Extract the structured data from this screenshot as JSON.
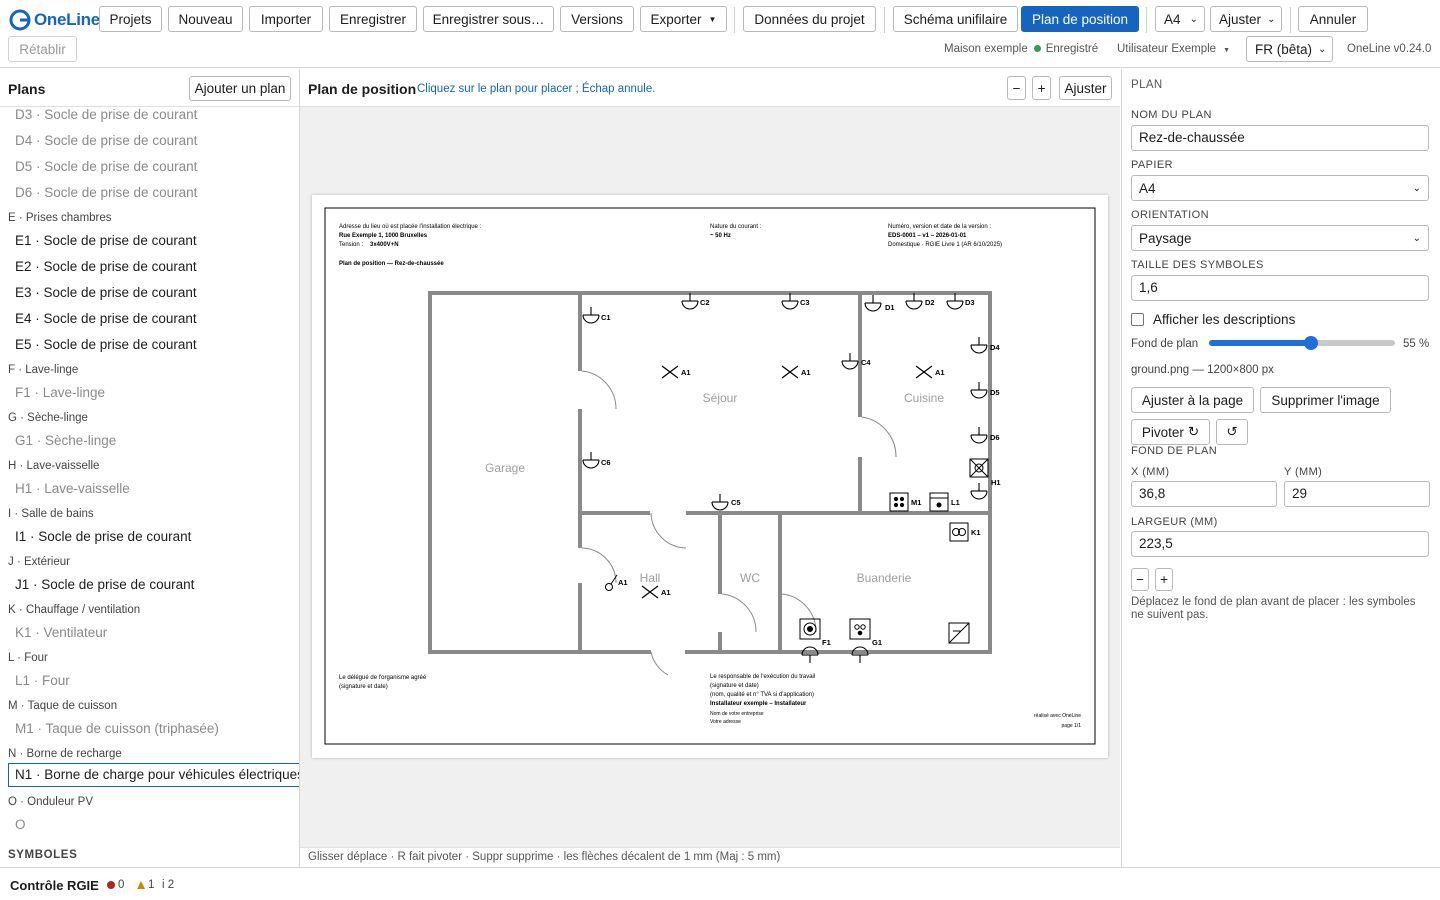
{
  "app": {
    "name": "OneLine",
    "version": "OneLine v0.24.0",
    "accent": "#1565c0"
  },
  "toolbar": {
    "projects": "Projets",
    "new": "Nouveau",
    "import": "Importer",
    "save": "Enregistrer",
    "save_as": "Enregistrer sous…",
    "versions": "Versions",
    "export": "Exporter",
    "project_data": "Données du projet",
    "single_line": "Schéma unifilaire",
    "position_plan": "Plan de position",
    "paper": "A4",
    "fit": "Ajuster",
    "undo": "Annuler",
    "redo": "Rétablir"
  },
  "status": {
    "project": "Maison exemple",
    "saved": "Enregistré",
    "user": "Utilisateur Exemple",
    "language": "FR (bêta)"
  },
  "left": {
    "title": "Plans",
    "add_plan": "Ajouter un plan",
    "groups": [
      {
        "items": [
          {
            "label": "D3 · Socle de prise de courant",
            "placed": false
          },
          {
            "label": "D4 · Socle de prise de courant",
            "placed": false
          },
          {
            "label": "D5 · Socle de prise de courant",
            "placed": false
          },
          {
            "label": "D6 · Socle de prise de courant",
            "placed": false
          }
        ]
      },
      {
        "label": "E · Prises chambres",
        "items": [
          {
            "label": "E1 · Socle de prise de courant",
            "placed": true
          },
          {
            "label": "E2 · Socle de prise de courant",
            "placed": true
          },
          {
            "label": "E3 · Socle de prise de courant",
            "placed": true
          },
          {
            "label": "E4 · Socle de prise de courant",
            "placed": true
          },
          {
            "label": "E5 · Socle de prise de courant",
            "placed": true
          }
        ]
      },
      {
        "label": "F · Lave-linge",
        "items": [
          {
            "label": "F1 · Lave-linge",
            "placed": false
          }
        ]
      },
      {
        "label": "G · Sèche-linge",
        "items": [
          {
            "label": "G1 · Sèche-linge",
            "placed": false
          }
        ]
      },
      {
        "label": "H · Lave-vaisselle",
        "items": [
          {
            "label": "H1 · Lave-vaisselle",
            "placed": false
          }
        ]
      },
      {
        "label": "I · Salle de bains",
        "items": [
          {
            "label": "I1 · Socle de prise de courant",
            "placed": true
          }
        ]
      },
      {
        "label": "J · Extérieur",
        "items": [
          {
            "label": "J1 · Socle de prise de courant",
            "placed": true
          }
        ]
      },
      {
        "label": "K · Chauffage / ventilation",
        "items": [
          {
            "label": "K1 · Ventilateur",
            "placed": false
          }
        ]
      },
      {
        "label": "L · Four",
        "items": [
          {
            "label": "L1 · Four",
            "placed": false
          }
        ]
      },
      {
        "label": "M · Taque de cuisson",
        "items": [
          {
            "label": "M1 · Taque de cuisson (triphasée)",
            "placed": false
          }
        ]
      },
      {
        "label": "N · Borne de recharge",
        "items": [
          {
            "label": "N1 · Borne de charge pour véhicules électriques",
            "placed": true,
            "selected": true
          }
        ]
      },
      {
        "label": "O · Onduleur PV",
        "items": [
          {
            "label": "O",
            "placed": false
          }
        ]
      }
    ],
    "symbols_heading": "SYMBOLES"
  },
  "center": {
    "title": "Plan de position",
    "hint": "Cliquez sur le plan pour placer ; Échap annule.",
    "zoom_out": "−",
    "zoom_in": "+",
    "fit": "Ajuster",
    "footer": "Glisser déplace · R fait pivoter · Suppr supprime · les flèches décalent de 1 mm (Maj : 5 mm)"
  },
  "sheet": {
    "address_label": "Adresse du lieu où est placée l'installation électrique :",
    "address": "Rue Exemple 1, 1000 Bruxelles",
    "voltage_label": "Tension :",
    "voltage": "3x400V+N",
    "current_label": "Nature du courant :",
    "current": "~ 50 Hz",
    "version_label": "Numéro, version et date de la version :",
    "version": "EDS-0001 – v1 – 2026-01-01",
    "regulation": "Domestique · RGIE Livre 1 (AR 6/10/2025)",
    "plan_title": "Plan de position — Rez-de-chaussée",
    "delegate_1": "Le délégué de l'organisme agréé",
    "delegate_2": "(signature et date)",
    "resp_1": "Le responsable de l'exécution du travail",
    "resp_2": "(signature et date)",
    "resp_3": "(nom, qualité et n° TVA si d'application)",
    "installer": "Installateur exemple – Installateur",
    "company": "Nom de votre entreprise",
    "company_address": "Votre adresse",
    "made_with": "réalisé avec OneLine",
    "page": "page 1/1",
    "rooms": {
      "garage": "Garage",
      "sejour": "Séjour",
      "cuisine": "Cuisine",
      "hall": "Hall",
      "wc": "WC",
      "buanderie": "Buanderie"
    },
    "symbols": {
      "c1": "C1",
      "c2": "C2",
      "c3": "C3",
      "c4": "C4",
      "c5": "C5",
      "c6": "C6",
      "d1": "D1",
      "d2": "D2",
      "d3": "D3",
      "d4": "D4",
      "d5": "D5",
      "d6": "D6",
      "a1": "A1",
      "h1": "H1",
      "m1": "M1",
      "l1": "L1",
      "k1": "K1",
      "f1": "F1",
      "g1": "G1"
    }
  },
  "right": {
    "section": "PLAN",
    "name_label": "NOM DU PLAN",
    "name_value": "Rez-de-chaussée",
    "paper_label": "PAPIER",
    "paper_value": "A4",
    "orientation_label": "ORIENTATION",
    "orientation_value": "Paysage",
    "symbol_size_label": "TAILLE DES SYMBOLES",
    "symbol_size_value": "1,6",
    "show_desc": "Afficher les descriptions",
    "background_label": "Fond de plan",
    "background_pct": "55 %",
    "background_fraction": 0.55,
    "file": "ground.png — 1200×800 px",
    "fit_page": "Ajuster à la page",
    "remove_image": "Supprimer l'image",
    "rotate": "Pivoter",
    "bg_heading": "FOND DE PLAN",
    "x_label": "X (MM)",
    "x_value": "36,8",
    "y_label": "Y (MM)",
    "y_value": "29",
    "width_label": "LARGEUR (MM)",
    "width_value": "223,5",
    "minus": "−",
    "plus": "+",
    "note": "Déplacez le fond de plan avant de placer : les symboles ne suivent pas."
  },
  "bottom": {
    "title": "Contrôle RGIE",
    "errors": "0",
    "warnings": "1",
    "infos": "i 2"
  }
}
